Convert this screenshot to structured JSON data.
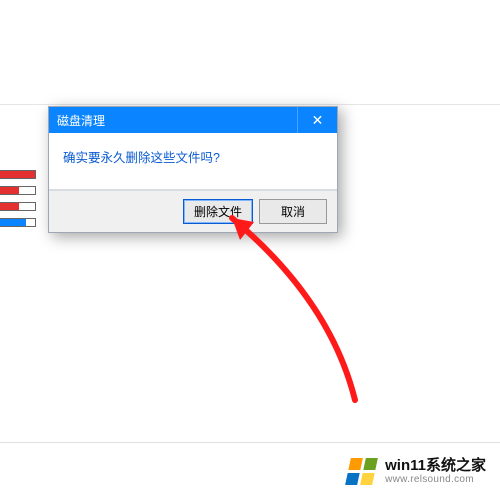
{
  "dialog": {
    "title": "磁盘清理",
    "message": "确实要永久删除这些文件吗?",
    "primary_label": "删除文件",
    "cancel_label": "取消",
    "close_glyph": "✕"
  },
  "branding": {
    "line1": "win11系统之家",
    "line2": "www.relsound.com"
  },
  "colors": {
    "titlebar": "#0a84ff",
    "arrow": "#ff1a1a"
  }
}
